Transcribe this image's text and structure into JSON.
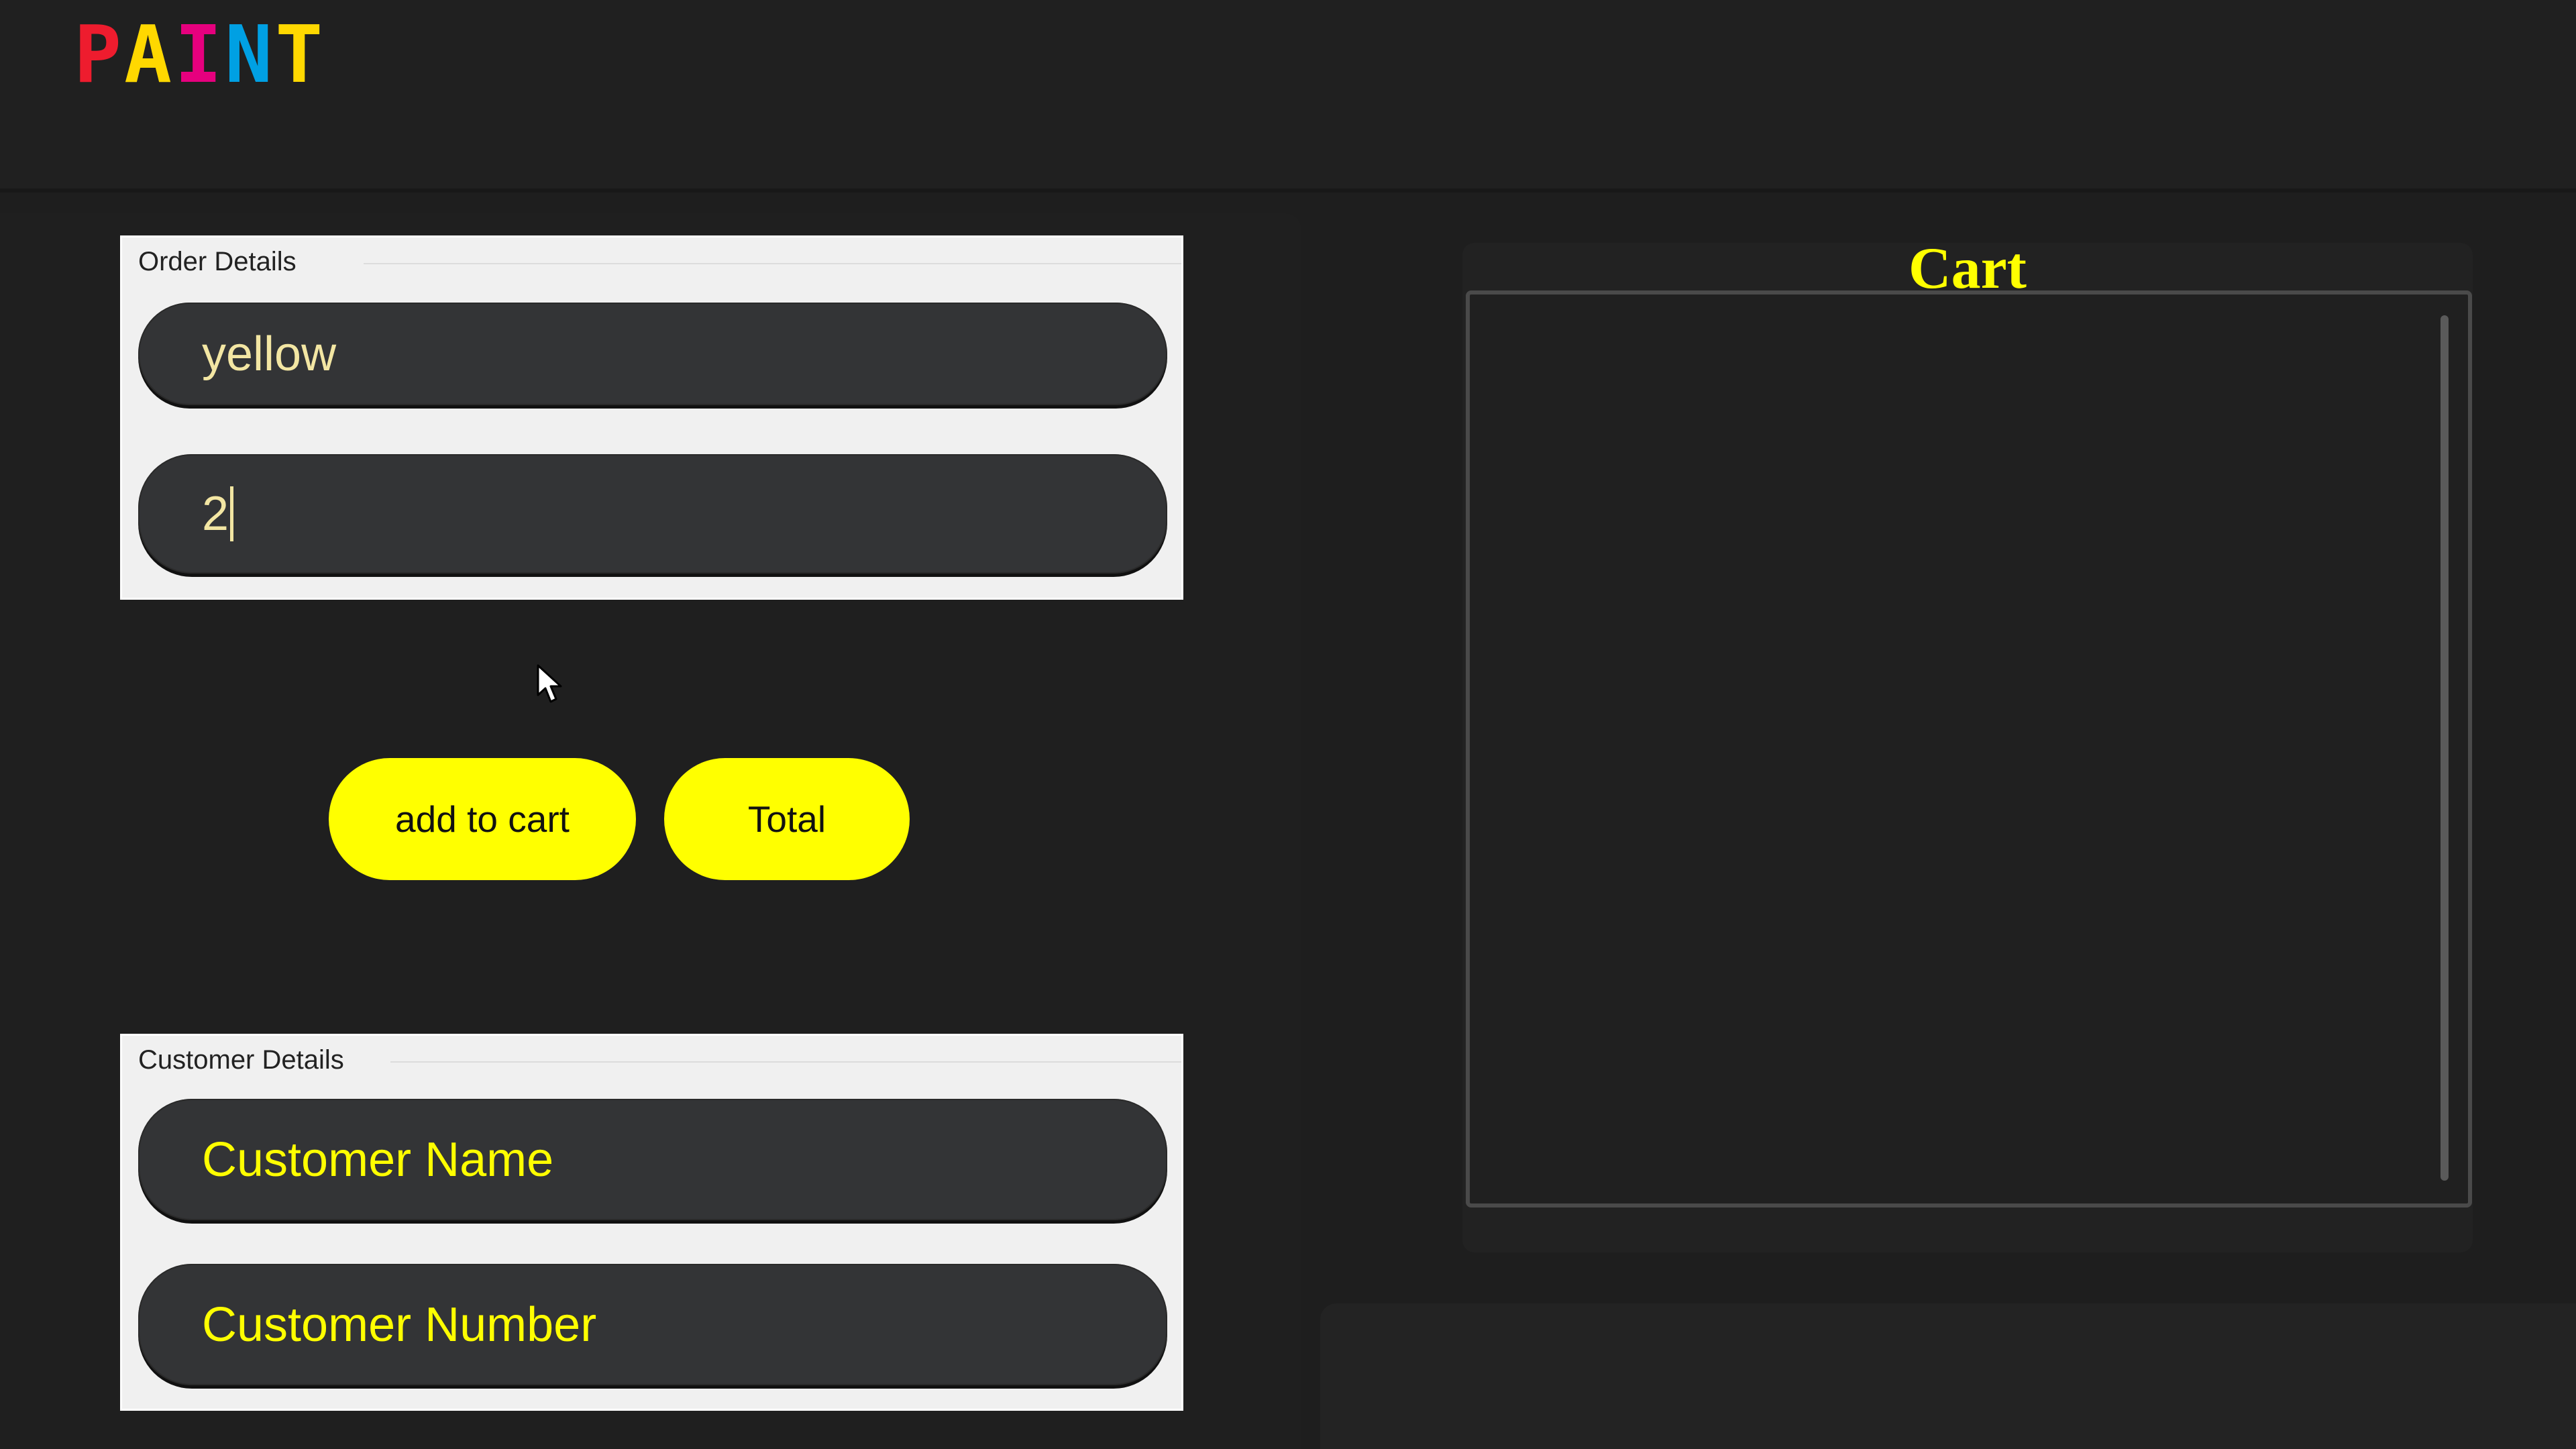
{
  "logo": {
    "letters": [
      {
        "char": "P",
        "color": "#ee1c2e"
      },
      {
        "char": "A",
        "color": "#ffd800"
      },
      {
        "char": "I",
        "color": "#e6007e"
      },
      {
        "char": "N",
        "color": "#00a0e3"
      },
      {
        "char": "T",
        "color": "#ffd800"
      }
    ]
  },
  "order_details": {
    "title": "Order Details",
    "color_value": "yellow",
    "quantity_value": "2"
  },
  "buttons": {
    "add_to_cart": "add to cart",
    "total": "Total"
  },
  "customer_details": {
    "title": "Customer Details",
    "name_placeholder": "Customer Name",
    "number_placeholder": "Customer Number"
  },
  "cart": {
    "title": "Cart",
    "items": []
  },
  "colors": {
    "accent": "#ffff00",
    "background": "#1e1e1e",
    "input_bg": "#333436"
  }
}
